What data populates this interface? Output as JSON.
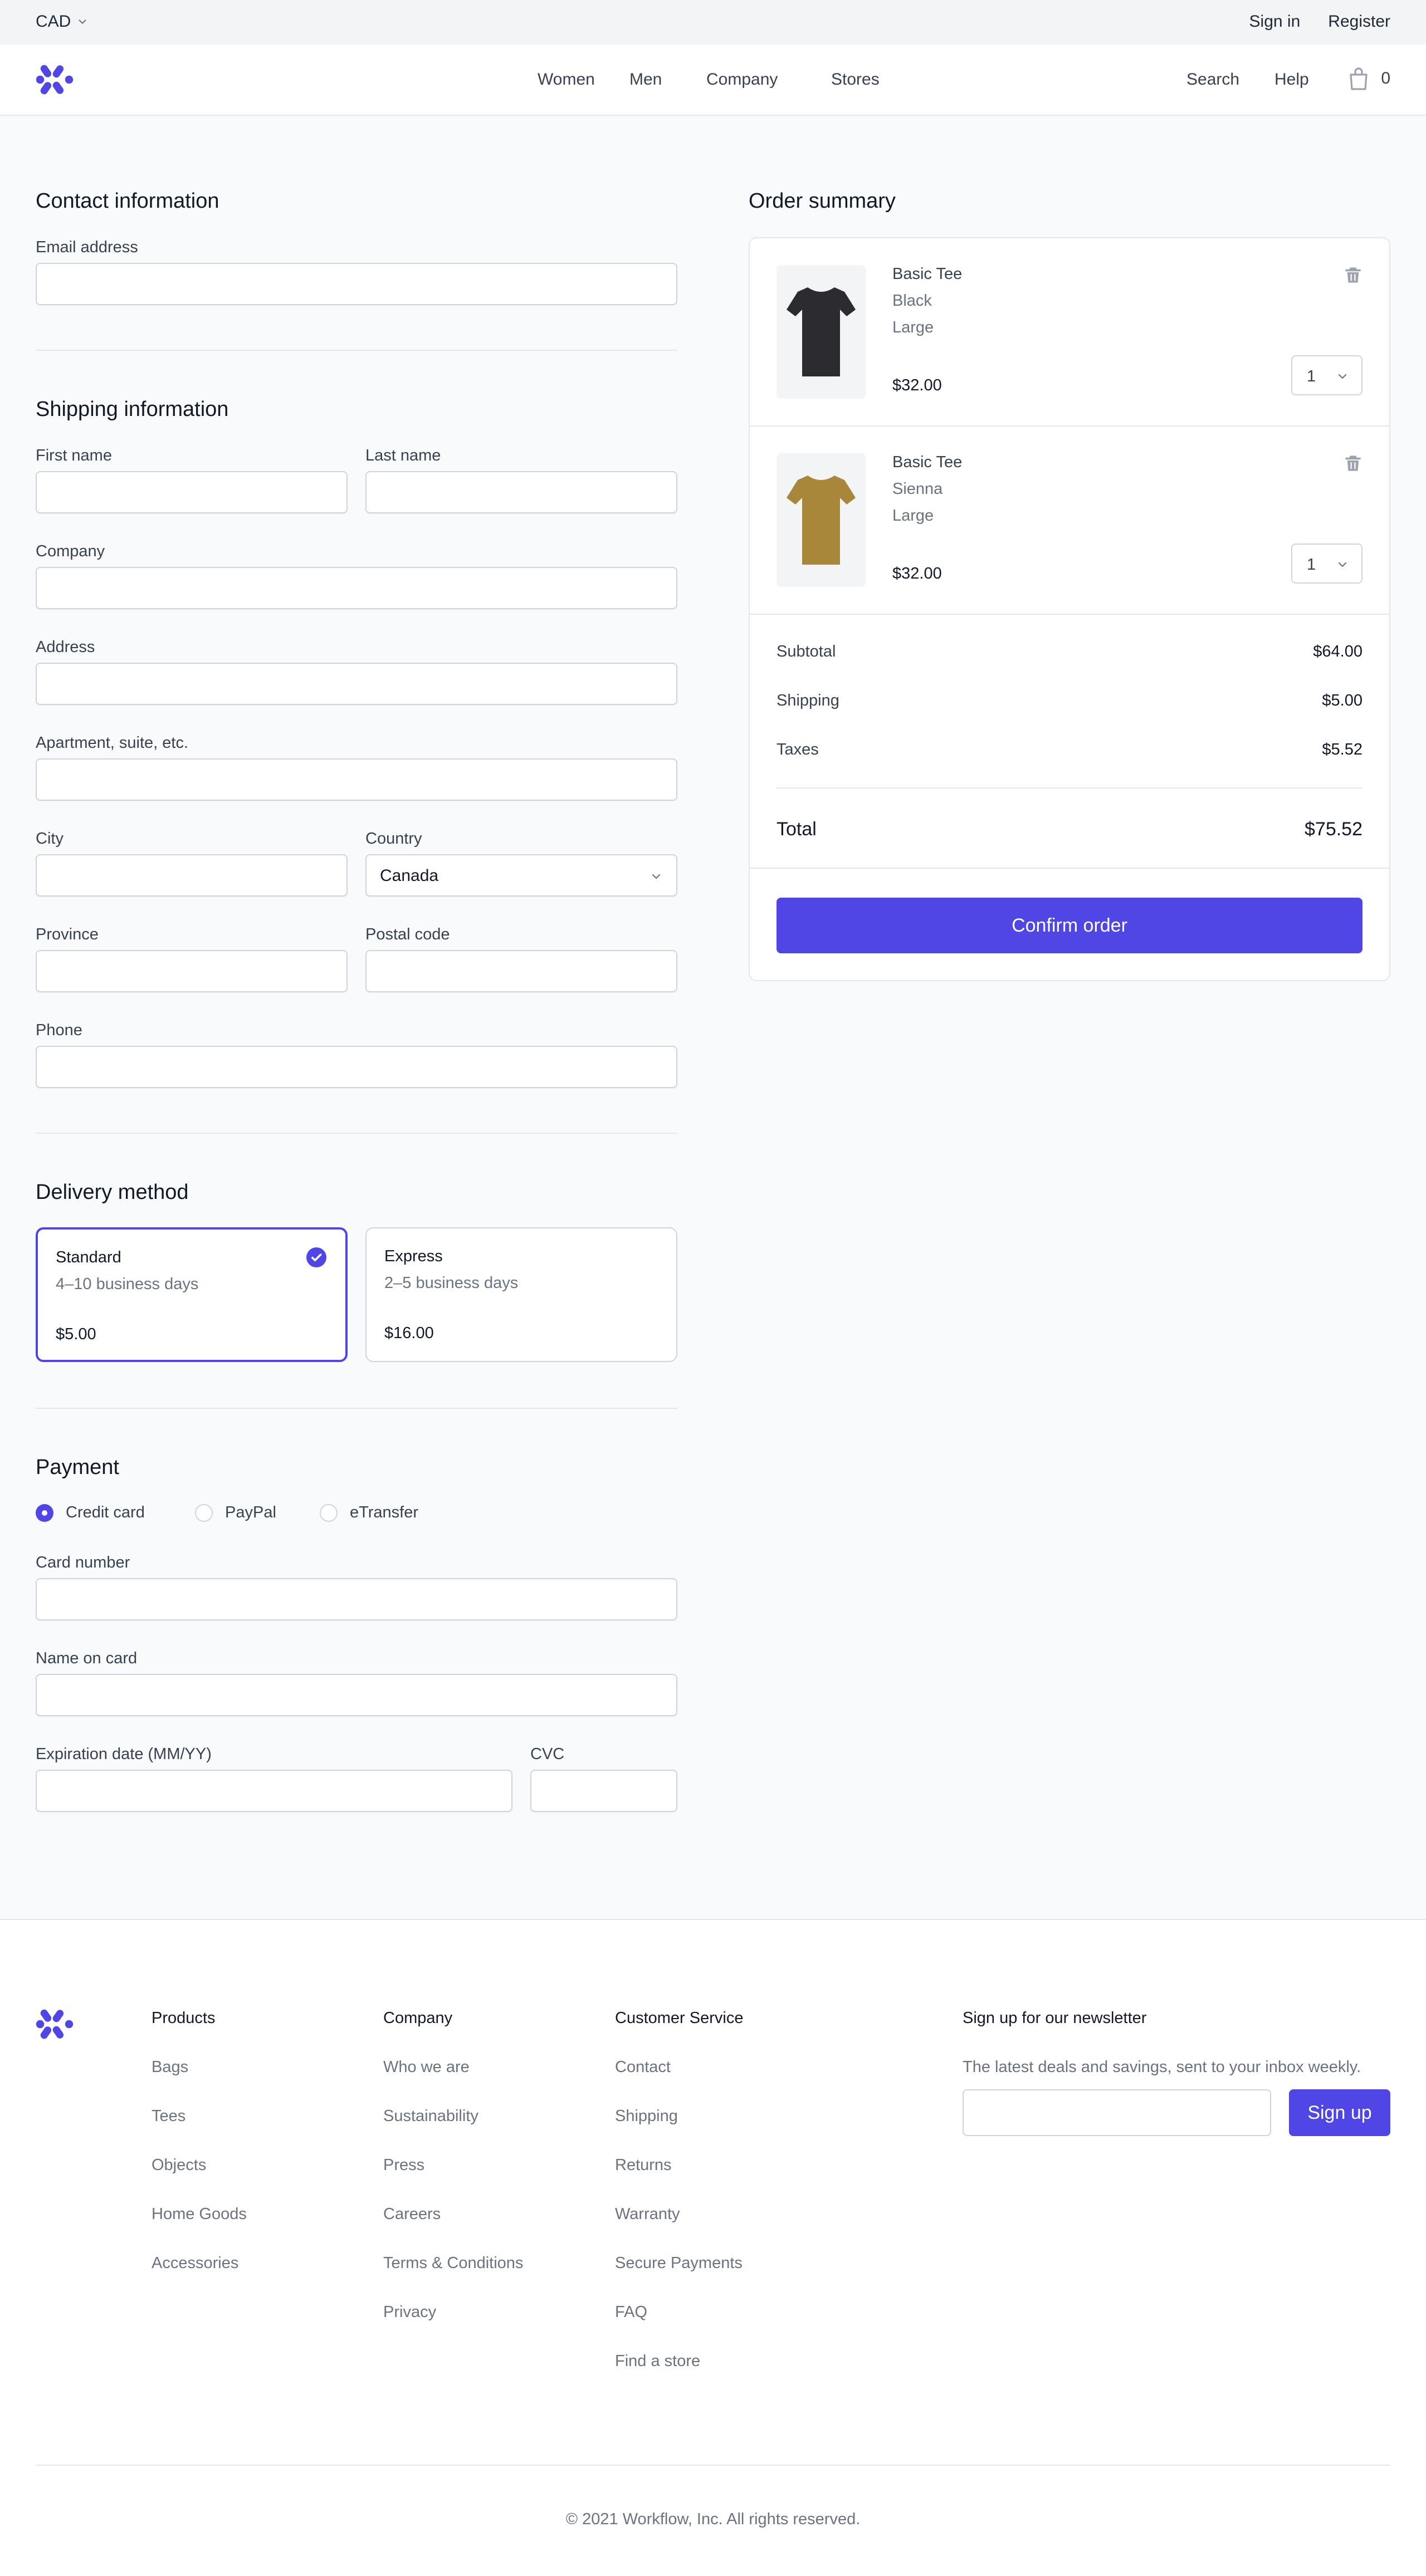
{
  "topbar": {
    "currency": "CAD",
    "sign_in": "Sign in",
    "register": "Register"
  },
  "header": {
    "nav": [
      "Women",
      "Men",
      "Company",
      "Stores"
    ],
    "search": "Search",
    "help": "Help",
    "cart_count": "0"
  },
  "contact": {
    "title": "Contact information",
    "email_label": "Email address"
  },
  "shipping": {
    "title": "Shipping information",
    "first_name": "First name",
    "last_name": "Last name",
    "company": "Company",
    "address": "Address",
    "apartment": "Apartment, suite, etc.",
    "city": "City",
    "country": "Country",
    "country_value": "Canada",
    "province": "Province",
    "postal_code": "Postal code",
    "phone": "Phone"
  },
  "delivery": {
    "title": "Delivery method",
    "options": [
      {
        "title": "Standard",
        "time": "4–10 business days",
        "price": "$5.00",
        "selected": true
      },
      {
        "title": "Express",
        "time": "2–5 business days",
        "price": "$16.00",
        "selected": false
      }
    ]
  },
  "payment": {
    "title": "Payment",
    "methods": [
      "Credit card",
      "PayPal",
      "eTransfer"
    ],
    "selected_method": "Credit card",
    "card_number": "Card number",
    "name_on_card": "Name on card",
    "expiration": "Expiration date (MM/YY)",
    "cvc": "CVC"
  },
  "summary": {
    "title": "Order summary",
    "items": [
      {
        "name": "Basic Tee",
        "color": "Black",
        "size": "Large",
        "price": "$32.00",
        "qty": "1",
        "shirt_color": "#2b2b30"
      },
      {
        "name": "Basic Tee",
        "color": "Sienna",
        "size": "Large",
        "price": "$32.00",
        "qty": "1",
        "shirt_color": "#a8863a"
      }
    ],
    "subtotal_label": "Subtotal",
    "subtotal": "$64.00",
    "shipping_label": "Shipping",
    "shipping": "$5.00",
    "taxes_label": "Taxes",
    "taxes": "$5.52",
    "total_label": "Total",
    "total": "$75.52",
    "confirm": "Confirm order"
  },
  "footer": {
    "columns": [
      {
        "title": "Products",
        "links": [
          "Bags",
          "Tees",
          "Objects",
          "Home Goods",
          "Accessories"
        ]
      },
      {
        "title": "Company",
        "links": [
          "Who we are",
          "Sustainability",
          "Press",
          "Careers",
          "Terms & Conditions",
          "Privacy"
        ]
      },
      {
        "title": "Customer Service",
        "links": [
          "Contact",
          "Shipping",
          "Returns",
          "Warranty",
          "Secure Payments",
          "FAQ",
          "Find a store"
        ]
      }
    ],
    "newsletter_title": "Sign up for our newsletter",
    "newsletter_sub": "The latest deals and savings, sent to your inbox weekly.",
    "signup": "Sign up",
    "copyright": "© 2021 Workflow, Inc. All rights reserved."
  },
  "colors": {
    "accent": "#4f46e5"
  },
  "icons": [
    "chevron-down-icon",
    "logo-icon",
    "shopping-bag-icon",
    "check-circle-icon",
    "trash-icon"
  ]
}
